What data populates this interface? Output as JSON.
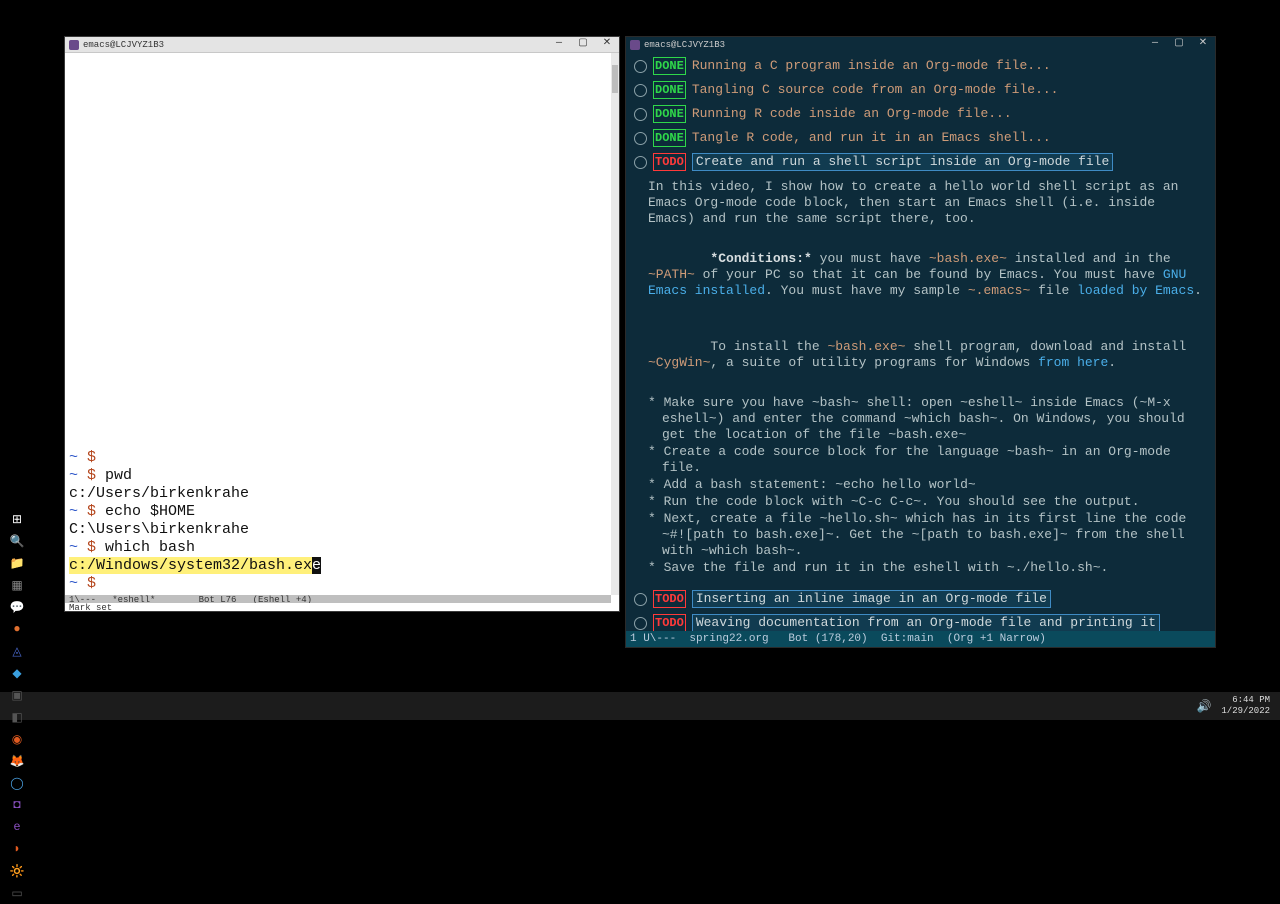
{
  "left_window": {
    "title": "emacs@LCJVYZ1B3",
    "terminal_lines": [
      {
        "tilde": "~",
        "dollar": "$",
        "cmd": ""
      },
      {
        "tilde": "~",
        "dollar": "$",
        "cmd": "pwd"
      },
      {
        "output": "c:/Users/birkenkrahe"
      },
      {
        "tilde": "~",
        "dollar": "$",
        "cmd": "echo $HOME"
      },
      {
        "output": "C:\\Users\\birkenkrahe"
      },
      {
        "tilde": "~",
        "dollar": "$",
        "cmd": "which bash"
      },
      {
        "hl": "c:/Windows/system32/bash.ex",
        "cursor": "e"
      },
      {
        "tilde": "~",
        "dollar": "$",
        "cmd": ""
      }
    ],
    "modeline": "1\\---   *eshell*        Bot L76   (Eshell +4)",
    "minibuf": "Mark set"
  },
  "right_window": {
    "title": "emacs@LCJVYZ1B3",
    "outline_top": [
      {
        "kw": "DONE",
        "kind": "done",
        "text": "Running a C program inside an Org-mode file..."
      },
      {
        "kw": "DONE",
        "kind": "done",
        "text": "Tangling C source code from an Org-mode file..."
      },
      {
        "kw": "DONE",
        "kind": "done",
        "text": "Running R code inside an Org-mode file..."
      },
      {
        "kw": "DONE",
        "kind": "done",
        "text": "Tangle R code, and run it in an Emacs shell..."
      },
      {
        "kw": "TODO",
        "kind": "todo",
        "text": "Create and run a shell script inside an Org-mode file",
        "boxed": true
      }
    ],
    "para1": "In this video, I show how to create a hello world shell script as an Emacs Org-mode code block, then start an Emacs shell (i.e. inside Emacs) and run the same script there, too.",
    "conditions_label": "*Conditions:*",
    "para2_a": " you must have ",
    "para2_code1": "~bash.exe~",
    "para2_b": " installed and in the ",
    "para2_code2": "~PATH~",
    "para2_c": " of your PC so that it can be found by Emacs. You must have ",
    "para2_link1": "GNU Emacs installed",
    "para2_d": ". You must have my sample ",
    "para2_code3": "~.emacs~",
    "para2_e": " file ",
    "para2_link2": "loaded by Emacs",
    "para2_f": ".",
    "para3_a": "To install the ",
    "para3_code1": "~bash.exe~",
    "para3_b": " shell program, download and install ",
    "para3_code2": "~CygWin~",
    "para3_c": ", a suite of utility programs for Windows ",
    "para3_link": "from here",
    "para3_d": ".",
    "bullets": [
      {
        "pre": "Make sure you have ",
        "c1": "~bash~",
        "mid1": " shell: open ",
        "c2": "~eshell~",
        "mid2": " inside Emacs (",
        "c3": "~M-x eshell~",
        "mid3": ") and enter the command ",
        "c4": "~which bash~",
        "mid4": ". On Windows, you should get the location of the file ",
        "c5": "~bash.exe~",
        "tail": ""
      },
      {
        "pre": "Create a code source block for the language ",
        "c1": "~bash~",
        "tail": " in an Org-mode file."
      },
      {
        "pre": "Add a bash statement: ",
        "c1": "~echo hello world~",
        "tail": ""
      },
      {
        "pre": "Run the code block with ",
        "c1": "~C-c C-c~",
        "tail": ". You should see the output."
      },
      {
        "pre": "Next, create a file ",
        "c1": "~hello.sh~",
        "mid1": " which has in its first line the code ",
        "c2": "~#![path to bash.exe]~",
        "mid2": ". Get the ",
        "c3": "~[path to bash.exe]~",
        "mid3": " from the shell with ",
        "c4": "~which bash~",
        "tail": "."
      },
      {
        "pre": "Save the file and run it in the eshell with ",
        "c1": "~./hello.sh~",
        "tail": "."
      }
    ],
    "outline_bottom": [
      {
        "kw": "TODO",
        "kind": "todo",
        "text": "Inserting an inline image in an Org-mode file",
        "boxed": true
      },
      {
        "kw": "TODO",
        "kind": "todo",
        "text": "Weaving documentation from an Org-mode file and printing it",
        "boxed": true
      }
    ],
    "modeline": "1 U\\---  spring22.org   Bot (178,20)  Git:main  (Org +1 Narrow)"
  },
  "taskbar": {
    "icons": [
      "⊞",
      "🔍",
      "📁",
      "▦",
      "💬",
      "●",
      "◬",
      "◆",
      "▣",
      "◧",
      "◉",
      "🦊",
      "◯",
      "◘",
      "e",
      "◗",
      "🔆",
      "▭"
    ],
    "time": "6:44 PM",
    "date": "1/29/2022"
  }
}
